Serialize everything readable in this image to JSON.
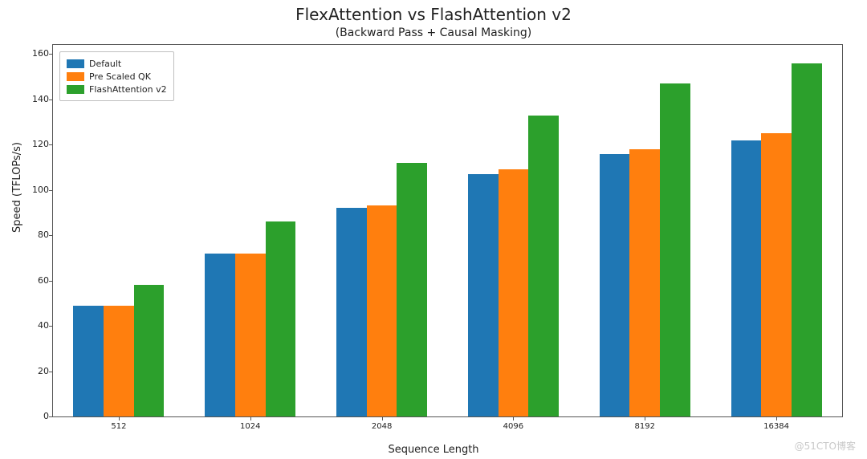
{
  "title": "FlexAttention vs FlashAttention v2",
  "subtitle": "(Backward Pass + Causal Masking)",
  "ylabel": "Speed (TFLOPs/s)",
  "xlabel": "Sequence Length",
  "watermark": "@51CTO博客",
  "legend": {
    "items": [
      "Default",
      "Pre Scaled QK",
      "FlashAttention v2"
    ]
  },
  "yticks": [
    "0",
    "20",
    "40",
    "60",
    "80",
    "100",
    "120",
    "140",
    "160"
  ],
  "chart_data": {
    "type": "bar",
    "title": "FlexAttention vs FlashAttention v2",
    "subtitle": "(Backward Pass + Causal Masking)",
    "xlabel": "Sequence Length",
    "ylabel": "Speed (TFLOPs/s)",
    "ylim": [
      0,
      164
    ],
    "categories": [
      "512",
      "1024",
      "2048",
      "4096",
      "8192",
      "16384"
    ],
    "series": [
      {
        "name": "Default",
        "values": [
          49,
          72,
          92,
          107,
          116,
          122
        ]
      },
      {
        "name": "Pre Scaled QK",
        "values": [
          49,
          72,
          93,
          109,
          118,
          125
        ]
      },
      {
        "name": "FlashAttention v2",
        "values": [
          58,
          86,
          112,
          133,
          147,
          156
        ]
      }
    ]
  }
}
